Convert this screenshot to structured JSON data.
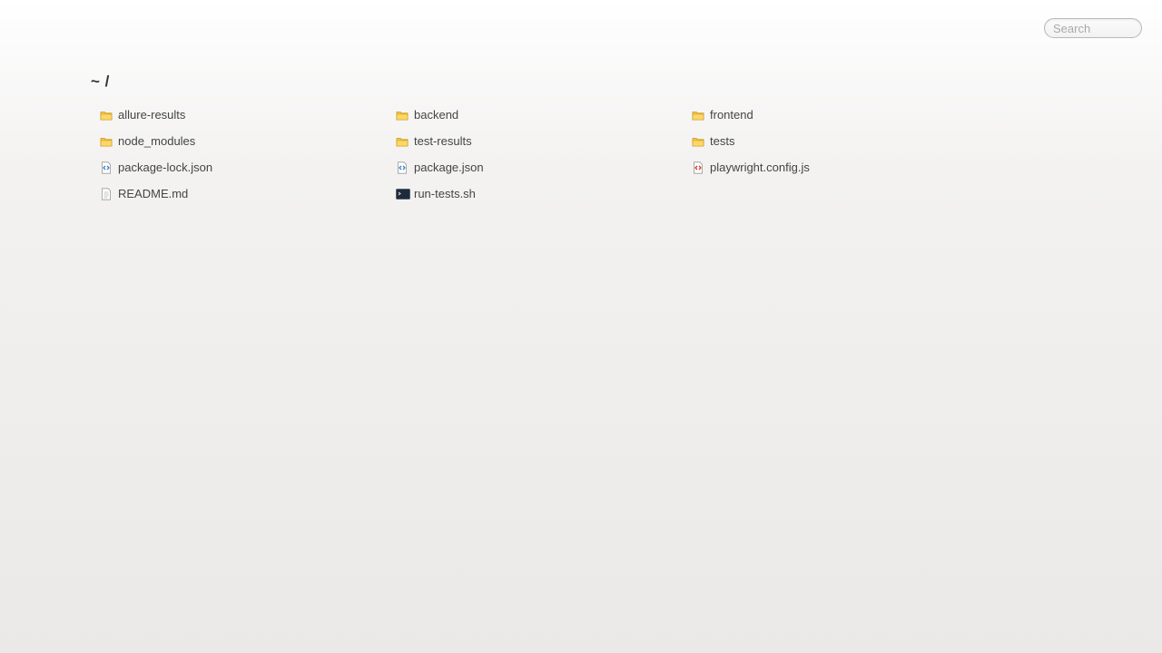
{
  "search": {
    "placeholder": "Search"
  },
  "breadcrumb": "~ /",
  "entries": [
    {
      "name": "allure-results",
      "icon": "folder-icon",
      "kind": "folder"
    },
    {
      "name": "backend",
      "icon": "folder-icon",
      "kind": "folder"
    },
    {
      "name": "frontend",
      "icon": "folder-icon",
      "kind": "folder"
    },
    {
      "name": "node_modules",
      "icon": "folder-icon",
      "kind": "folder"
    },
    {
      "name": "test-results",
      "icon": "folder-icon",
      "kind": "folder"
    },
    {
      "name": "tests",
      "icon": "folder-icon",
      "kind": "folder"
    },
    {
      "name": "package-lock.json",
      "icon": "json-file-icon",
      "kind": "json"
    },
    {
      "name": "package.json",
      "icon": "json-file-icon",
      "kind": "json"
    },
    {
      "name": "playwright.config.js",
      "icon": "js-file-icon",
      "kind": "js"
    },
    {
      "name": "README.md",
      "icon": "text-file-icon",
      "kind": "text"
    },
    {
      "name": "run-tests.sh",
      "icon": "terminal-file-icon",
      "kind": "shell"
    }
  ],
  "colors": {
    "folder": "#f5c542",
    "json_accent": "#3b82c4",
    "js_accent": "#d9342b",
    "terminal": "#1f2a3a"
  }
}
